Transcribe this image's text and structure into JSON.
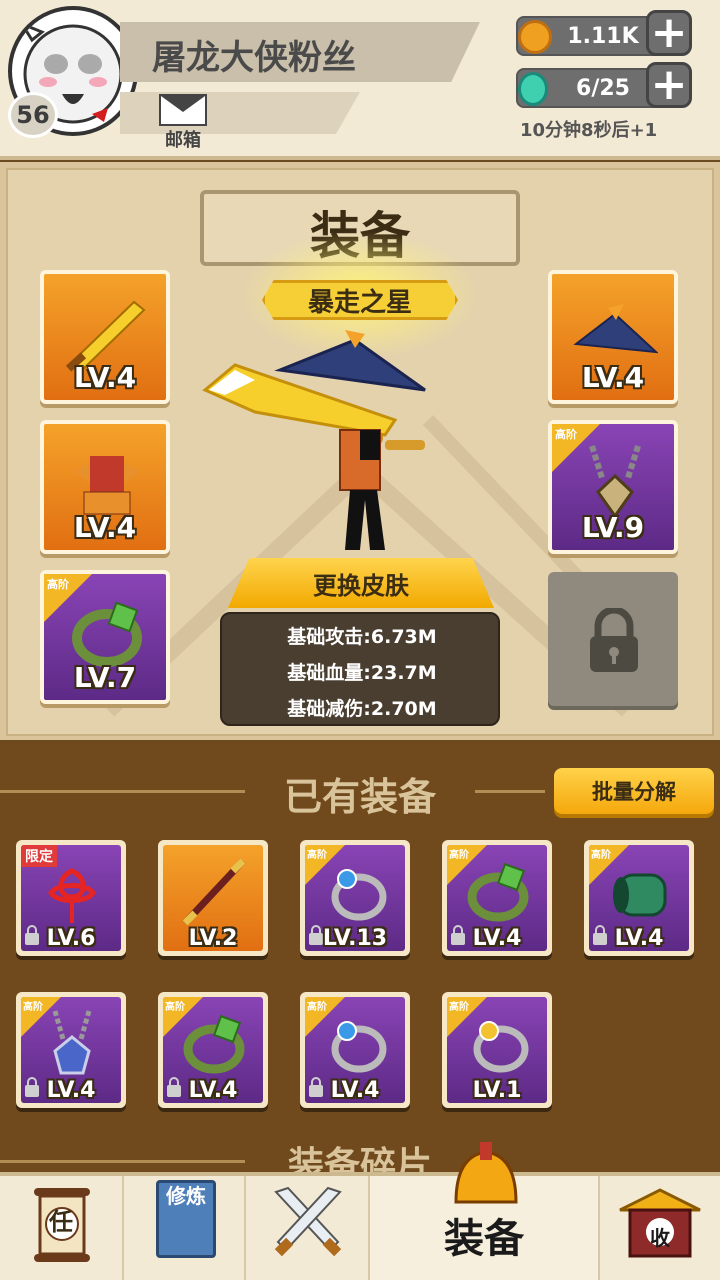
{
  "header": {
    "player_name": "屠龙大侠粉丝",
    "level": "56",
    "mail_label": "邮箱",
    "coins": "1.11K",
    "energy": "6/25",
    "timer_text": "10分钟8秒后+1"
  },
  "equip_panel": {
    "title": "装备",
    "skin_name": "暴走之星",
    "change_skin_label": "更换皮肤",
    "slots": [
      {
        "level": "LV.4",
        "icon": "golden-sword-icon",
        "rarity": "orange"
      },
      {
        "level": "LV.4",
        "icon": "straw-hat-icon",
        "rarity": "orange"
      },
      {
        "level": "LV.4",
        "icon": "armor-icon",
        "rarity": "orange"
      },
      {
        "level": "LV.9",
        "icon": "necklace-icon",
        "rarity": "purple",
        "tier": "高阶"
      },
      {
        "level": "LV.7",
        "icon": "jade-ring-icon",
        "rarity": "purple",
        "tier": "高阶"
      }
    ],
    "stats": {
      "attack": "基础攻击:6.73M",
      "hp": "基础血量:23.7M",
      "damage_reduction": "基础减伤:2.70M"
    }
  },
  "owned": {
    "title": "已有装备",
    "bulk_button": "批量分解",
    "items": [
      {
        "level": "LV.6",
        "icon": "chinese-knot-icon",
        "rarity": "purple",
        "badge": "限定",
        "locked": true
      },
      {
        "level": "LV.2",
        "icon": "staff-icon",
        "rarity": "orange",
        "locked": false
      },
      {
        "level": "LV.13",
        "icon": "pearl-ring-icon",
        "rarity": "purple",
        "badge": "高阶",
        "locked": true
      },
      {
        "level": "LV.4",
        "icon": "jade-ring-icon",
        "rarity": "purple",
        "badge": "高阶",
        "locked": true
      },
      {
        "level": "LV.4",
        "icon": "bracer-icon",
        "rarity": "purple",
        "badge": "高阶",
        "locked": true
      },
      {
        "level": "LV.4",
        "icon": "sapphire-necklace-icon",
        "rarity": "purple",
        "badge": "高阶",
        "locked": true
      },
      {
        "level": "LV.4",
        "icon": "jade-ring-icon",
        "rarity": "purple",
        "badge": "高阶",
        "locked": true
      },
      {
        "level": "LV.4",
        "icon": "pearl-ring-icon",
        "rarity": "purple",
        "badge": "高阶",
        "locked": true
      },
      {
        "level": "LV.1",
        "icon": "gold-pearl-ring-icon",
        "rarity": "purple",
        "badge": "高阶",
        "locked": false
      }
    ],
    "fragments_title": "装备碎片"
  },
  "nav": {
    "tasks": "任",
    "cultivate": "修炼",
    "battle_icon": "crossed-swords-icon",
    "equip": "装备",
    "collect": "收"
  },
  "colors": {
    "orange_rarity": "#e16f12",
    "purple_rarity": "#5d2a86",
    "accent_gold": "#f5a80c"
  }
}
